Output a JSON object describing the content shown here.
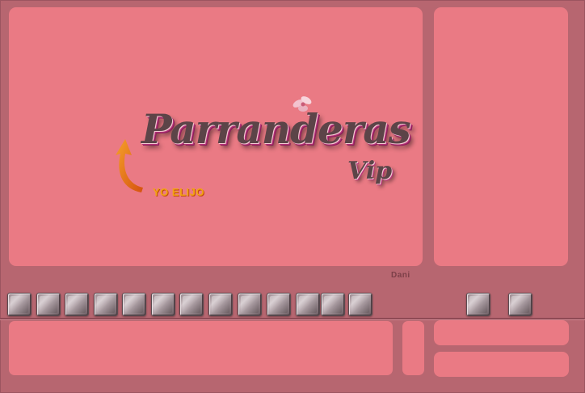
{
  "logo": {
    "title": "Parranderas",
    "subtitle": "Vip",
    "tagline": "YO ELIJO",
    "colors": {
      "text": "#5c4448",
      "accent": "#b8337a",
      "tag": "#f2a414"
    }
  },
  "user_label": "Dani",
  "toolbar": {
    "left_button_count": 13,
    "right_button_count": 2
  },
  "colors": {
    "background": "#b76670",
    "panel": "#ea7a84"
  }
}
